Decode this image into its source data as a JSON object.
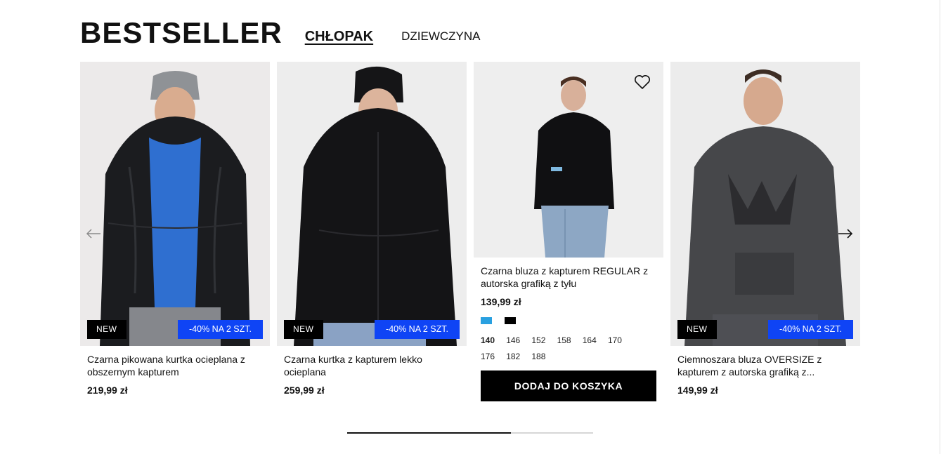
{
  "section": {
    "title": "BESTSELLER",
    "tabs": [
      {
        "label": "CHŁOPAK",
        "active": true
      },
      {
        "label": "DZIEWCZYNA",
        "active": false
      }
    ]
  },
  "products": [
    {
      "name": "Czarna pikowana kurtka ocieplana z obszernym kapturem",
      "price": "219,99 zł",
      "badge_new": "NEW",
      "badge_promo": "-40% NA 2 SZT."
    },
    {
      "name": "Czarna kurtka z kapturem lekko ocieplana",
      "price": "259,99 zł",
      "badge_new": "NEW",
      "badge_promo": "-40% NA 2 SZT."
    },
    {
      "name": "Czarna bluza z kapturem REGULAR z autorska grafiką z tyłu",
      "price": "139,99 zł",
      "colors": [
        "#29a0e0",
        "#000000"
      ],
      "sizes": [
        "140",
        "146",
        "152",
        "158",
        "164",
        "170",
        "176",
        "182",
        "188"
      ],
      "selected_size": "140",
      "add_to_cart": "DODAJ DO KOSZYKA"
    },
    {
      "name": "Ciemnoszara bluza OVERSIZE z kapturem z autorska grafiką z...",
      "price": "149,99 zł",
      "badge_new": "NEW",
      "badge_promo": "-40% NA 2 SZT."
    }
  ],
  "icons": {
    "prev": "arrow-left-icon",
    "next": "arrow-right-icon",
    "wishlist": "heart-icon"
  },
  "carousel": {
    "progress_fraction": 0.667
  },
  "colors": {
    "promo_badge": "#0f44f5",
    "new_badge": "#000000",
    "button": "#000000"
  }
}
